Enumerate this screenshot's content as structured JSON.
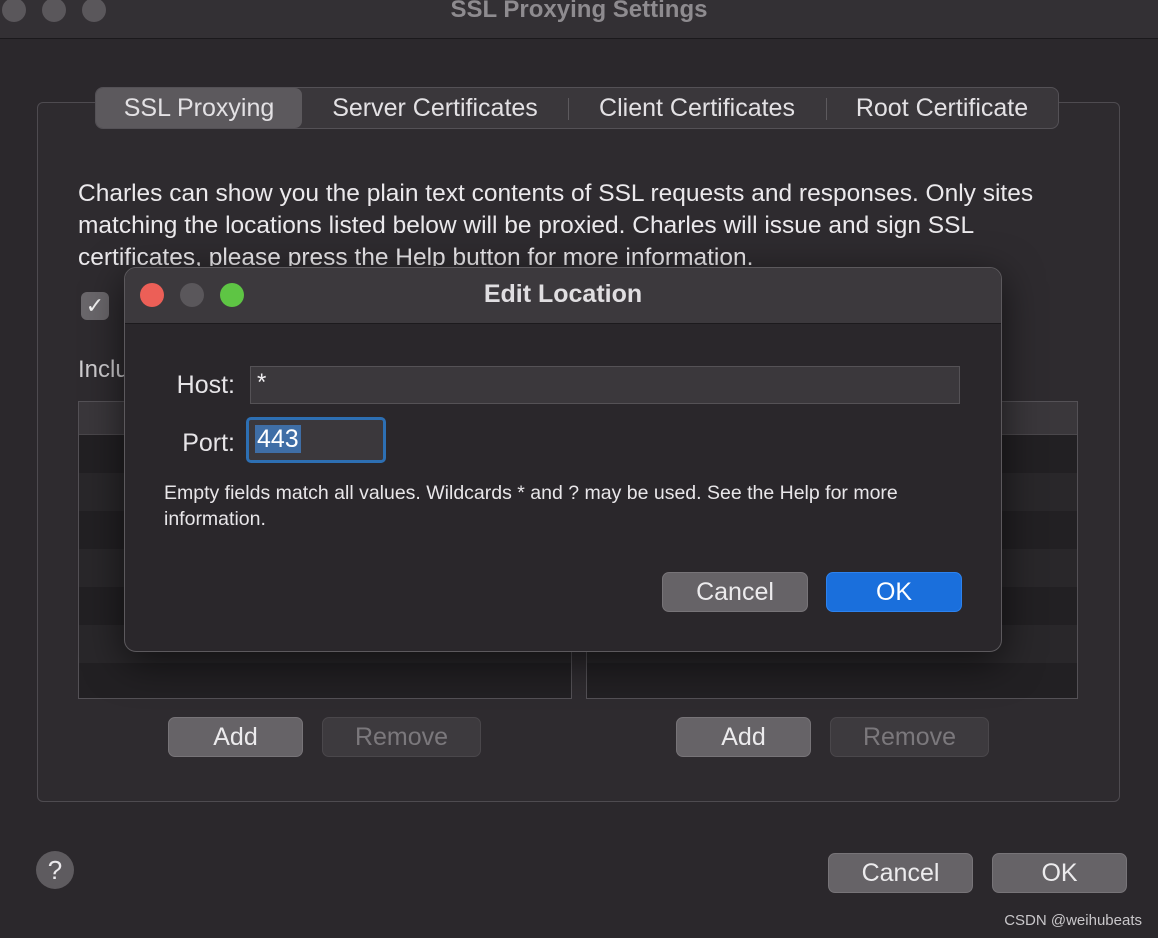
{
  "window": {
    "title": "SSL Proxying Settings"
  },
  "tabs": [
    {
      "label": "SSL Proxying",
      "active": true
    },
    {
      "label": "Server Certificates",
      "active": false
    },
    {
      "label": "Client Certificates",
      "active": false
    },
    {
      "label": "Root Certificate",
      "active": false
    }
  ],
  "description": "Charles can show you the plain text contents of SSL requests and responses. Only sites matching the locations listed below will be proxied. Charles will issue and sign SSL certificates, please press the Help button for more information.",
  "include": {
    "label": "Inclu"
  },
  "include_buttons": {
    "add": "Add",
    "remove": "Remove"
  },
  "exclude_buttons": {
    "add": "Add",
    "remove": "Remove"
  },
  "footer": {
    "help": "?",
    "cancel": "Cancel",
    "ok": "OK"
  },
  "dialog": {
    "title": "Edit Location",
    "host_label": "Host:",
    "host_value": "*",
    "port_label": "Port:",
    "port_value": "443",
    "hint": "Empty fields match all values. Wildcards * and ? may be used. See the Help for more information.",
    "cancel": "Cancel",
    "ok": "OK"
  },
  "watermark": "CSDN @weihubeats",
  "colors": {
    "accent": "#1a6fdc",
    "close": "#ec5f57",
    "minimize": "#5a575b",
    "zoom": "#5ec544"
  }
}
